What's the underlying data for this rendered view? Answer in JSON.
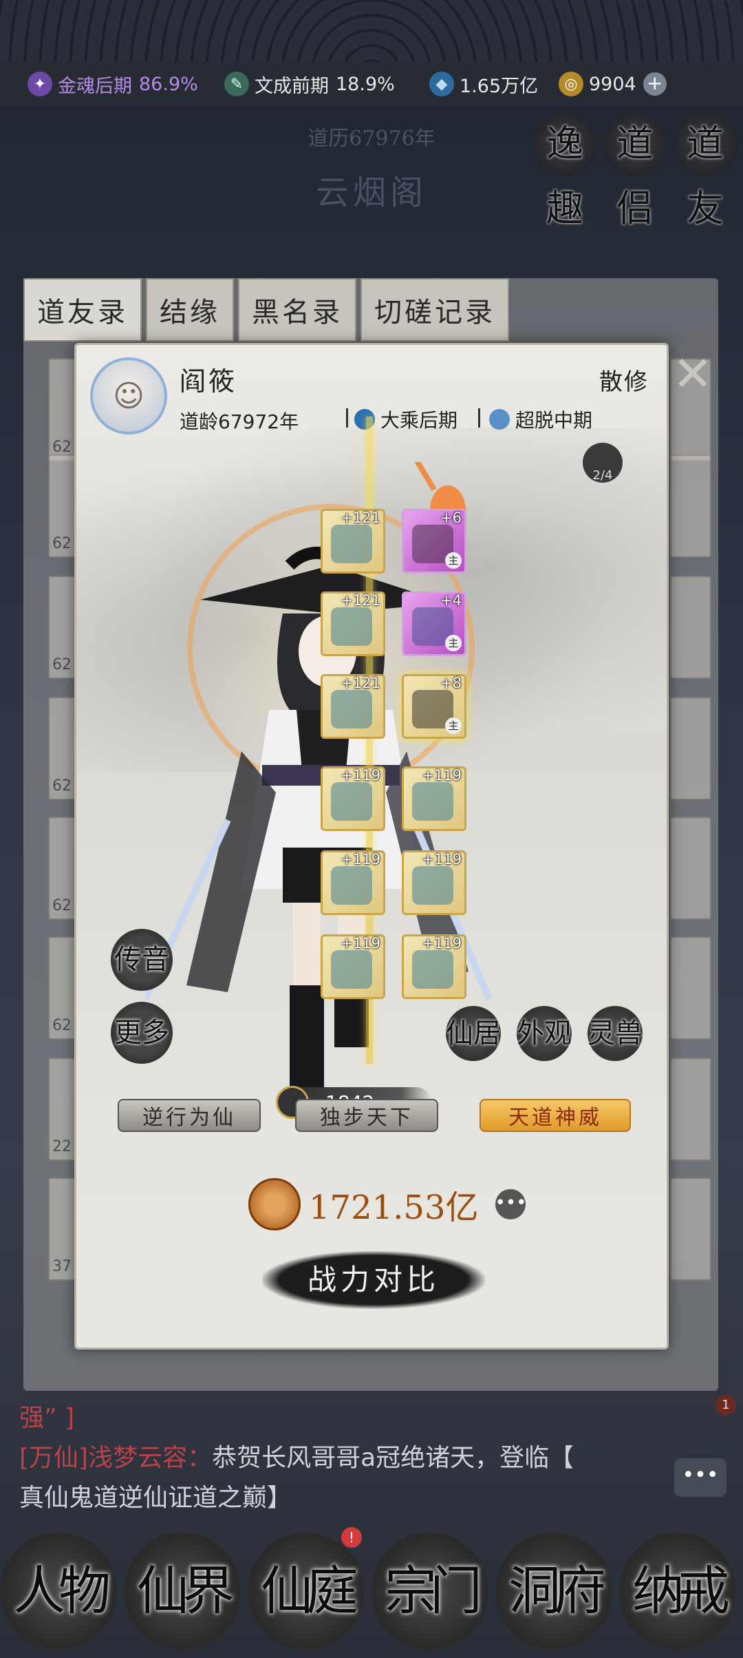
{
  "topbar": {
    "cultivation": {
      "label": "金魂后期",
      "percent": "86.9%",
      "color": "#b58be8"
    },
    "literary": {
      "label": "文成前期",
      "percent": "18.9%"
    },
    "spirit_stones": "1.65万亿",
    "jade": "9904",
    "add_icon": "plus-icon"
  },
  "header": {
    "calendar": "道历67976年",
    "location": "云烟阁"
  },
  "seals": [
    "逸趣",
    "道侣",
    "道友"
  ],
  "tabs": [
    "道友录",
    "结缘",
    "黑名录",
    "切磋记录"
  ],
  "list_behind": {
    "numbers": [
      "62",
      "62",
      "62",
      "62",
      "62",
      "62",
      "22",
      "37"
    ]
  },
  "profile": {
    "name": "阎筱",
    "role": "散修",
    "age": "道龄67972年",
    "realm1": "大乘后期",
    "realm2": "超脱中期",
    "badge_count": "2/4",
    "equipment": [
      {
        "level": "+121",
        "rarity": "gold",
        "main": ""
      },
      {
        "level": "+6",
        "rarity": "purple",
        "main": "主"
      },
      {
        "level": "+121",
        "rarity": "gold",
        "main": ""
      },
      {
        "level": "+4",
        "rarity": "purple",
        "main": "主"
      },
      {
        "level": "+121",
        "rarity": "gold",
        "main": ""
      },
      {
        "level": "+8",
        "rarity": "gold",
        "main": "主"
      },
      {
        "level": "+119",
        "rarity": "gold",
        "main": ""
      },
      {
        "level": "+119",
        "rarity": "gold",
        "main": ""
      },
      {
        "level": "+119",
        "rarity": "gold",
        "main": ""
      },
      {
        "level": "+119",
        "rarity": "gold",
        "main": ""
      },
      {
        "level": "+119",
        "rarity": "gold",
        "main": ""
      },
      {
        "level": "+119",
        "rarity": "gold",
        "main": ""
      }
    ],
    "left_buttons": [
      "传音",
      "更多"
    ],
    "bottom_buttons": [
      "仙居",
      "外观",
      "灵兽"
    ],
    "small_power": "1842",
    "titles": [
      "逆行为仙",
      "独步天下",
      "天道神威"
    ],
    "total_power": "1721.53亿",
    "compare_button": "战力对比"
  },
  "chat": {
    "line0": "强” ]",
    "tag": "[万仙]浅梦云容：",
    "line1_rest": "恭贺长风哥哥a冠绝诸天，登临【",
    "line2": "真仙鬼道逆仙证道之巅】",
    "notif_count": "1",
    "chat_icon": "chat-bubble-icon"
  },
  "nav": [
    "人物",
    "仙界",
    "仙庭",
    "宗门",
    "洞府",
    "纳戒"
  ],
  "nav_badge": "!"
}
